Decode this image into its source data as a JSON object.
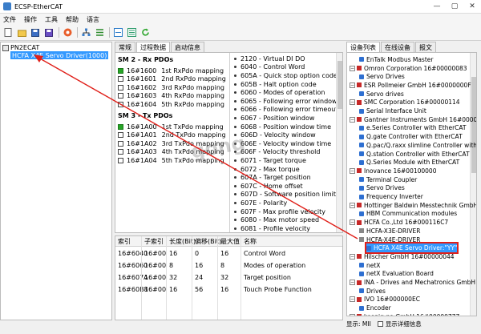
{
  "window": {
    "title": "ECSP-EtherCAT",
    "min": "—",
    "max": "▢",
    "close": "✕"
  },
  "menu": [
    "文件",
    "操作",
    "工具",
    "帮助",
    "语言"
  ],
  "toolbar_icons": [
    "new-icon",
    "open-icon",
    "save-icon",
    "save-as-icon",
    "color-icon",
    "network-icon",
    "settings-icon",
    "scan-icon",
    "list-icon",
    "refresh-icon"
  ],
  "tree": {
    "root": "PN2ECAT",
    "child": "HCFA X4E Servo Driver(1000)"
  },
  "tabs": [
    "常规",
    "过程数据",
    "启动信息"
  ],
  "pdo": {
    "rx_title": "SM 2 - Rx PDOs",
    "rx": [
      {
        "index": "16#1600",
        "name": "1st RxPdo mapping",
        "checked": true
      },
      {
        "index": "16#1601",
        "name": "2nd RxPdo mapping",
        "checked": false
      },
      {
        "index": "16#1602",
        "name": "3rd RxPdo mapping",
        "checked": false
      },
      {
        "index": "16#1603",
        "name": "4th RxPdo mapping",
        "checked": false
      },
      {
        "index": "16#1604",
        "name": "5th RxPdo mapping",
        "checked": false
      }
    ],
    "tx_title": "SM 3 - Tx PDOs",
    "tx": [
      {
        "index": "16#1A00",
        "name": "1st TxPdo mapping",
        "checked": true
      },
      {
        "index": "16#1A01",
        "name": "2nd TxPdo mapping",
        "checked": false
      },
      {
        "index": "16#1A02",
        "name": "3rd TxPdo mapping",
        "checked": false
      },
      {
        "index": "16#1A03",
        "name": "4th TxPdo mapping",
        "checked": false
      },
      {
        "index": "16#1A04",
        "name": "5th TxPdo mapping",
        "checked": false
      }
    ]
  },
  "objects": [
    "2120 - Virtual DI DO",
    "6040 - Control Word",
    "605A - Quick stop option code",
    "605B - Halt option code",
    "6060 - Modes of operation",
    "6065 - Following error window",
    "6066 - Following error timeout",
    "6067 - Position window",
    "6068 - Position window time",
    "606D - Velocity window",
    "606E - Velocity window time",
    "606F - Velocity threshold",
    "6071 - Target torque",
    "6072 - Max torque",
    "607A - Target position",
    "607C - Home offset",
    "607D - Software position limit",
    "607E - Polarity",
    "607F - Max profile velocity",
    "6080 - Max motor speed",
    "6081 - Profile velocity"
  ],
  "grid": {
    "headers": [
      "索引",
      "子索引",
      "长度(Bit)",
      "偏移(Bit)",
      "最大值",
      "名称"
    ],
    "rows": [
      [
        "16#6040",
        "16#00",
        "16",
        "0",
        "16",
        "Control Word"
      ],
      [
        "16#6060",
        "16#00",
        "8",
        "16",
        "8",
        "Modes of operation"
      ],
      [
        "16#607A",
        "16#00",
        "32",
        "24",
        "32",
        "Target position"
      ],
      [
        "16#60B8",
        "16#00",
        "16",
        "56",
        "16",
        "Touch Probe Function"
      ]
    ]
  },
  "right_tabs": [
    "设备列表",
    "在线设备",
    "报文"
  ],
  "devices": [
    {
      "text": "EnTalk Modbus Master",
      "level": 2,
      "kind": "dev"
    },
    {
      "text": "Omron Corporation   16#00000083",
      "level": 1,
      "kind": "vendor"
    },
    {
      "text": "Servo Drives",
      "level": 2,
      "kind": "dev"
    },
    {
      "text": "ESR Pollmeier GmbH   16#0000000F",
      "level": 1,
      "kind": "vendor"
    },
    {
      "text": "Servo drives",
      "level": 2,
      "kind": "dev"
    },
    {
      "text": "SMC Corporation   16#00000114",
      "level": 1,
      "kind": "vendor"
    },
    {
      "text": "Serial Interface Unit",
      "level": 2,
      "kind": "dev"
    },
    {
      "text": "Gantner Instruments GmbH   16#000000B4",
      "level": 1,
      "kind": "vendor"
    },
    {
      "text": "e.Series Controller with EtherCAT",
      "level": 2,
      "kind": "dev"
    },
    {
      "text": "Q.gate Controller with EtherCAT",
      "level": 2,
      "kind": "dev"
    },
    {
      "text": "Q.pac/Q.raxx slimline Controller with",
      "level": 2,
      "kind": "dev"
    },
    {
      "text": "Q.station Controller with EtherCAT",
      "level": 2,
      "kind": "dev"
    },
    {
      "text": "Q.Series Module with EtherCAT",
      "level": 2,
      "kind": "dev"
    },
    {
      "text": "Inovance   16#00100000",
      "level": 1,
      "kind": "vendor"
    },
    {
      "text": "Terminal Coupler",
      "level": 2,
      "kind": "dev"
    },
    {
      "text": "Servo Drives",
      "level": 2,
      "kind": "dev"
    },
    {
      "text": "Frequency Inverter",
      "level": 2,
      "kind": "dev"
    },
    {
      "text": "Hottinger Baldwin Messtechnik GmbH",
      "level": 1,
      "kind": "vendor"
    },
    {
      "text": "HBM Communication modules",
      "level": 2,
      "kind": "dev"
    },
    {
      "text": "HCFA Co.,Ltd   16#000116C7",
      "level": 1,
      "kind": "vendor"
    },
    {
      "text": "HCFA-X3E-DRIVER",
      "level": 2,
      "kind": "grp"
    },
    {
      "text": "HCFA-X4E-DRIVER",
      "level": 2,
      "kind": "grp"
    },
    {
      "text": "HCFA X4E Servo Driver:\"YY\"",
      "level": 3,
      "kind": "dev",
      "selected": true
    },
    {
      "text": "Hilscher GmbH   16#00000044",
      "level": 1,
      "kind": "vendor"
    },
    {
      "text": "netX",
      "level": 2,
      "kind": "dev"
    },
    {
      "text": "netX Evaluation Board",
      "level": 2,
      "kind": "dev"
    },
    {
      "text": "INA - Drives and Mechatronics GmbH u",
      "level": 1,
      "kind": "vendor"
    },
    {
      "text": "Drives",
      "level": 2,
      "kind": "dev"
    },
    {
      "text": "IVO   16#000000EC",
      "level": 1,
      "kind": "vendor"
    },
    {
      "text": "Encoder",
      "level": 2,
      "kind": "dev"
    },
    {
      "text": "koenig-pa GmbH   16#00000777",
      "level": 1,
      "kind": "vendor"
    }
  ],
  "status": {
    "left": "显示: MII",
    "checkbox_label": "显示详细信息"
  },
  "watermark": "gong"
}
